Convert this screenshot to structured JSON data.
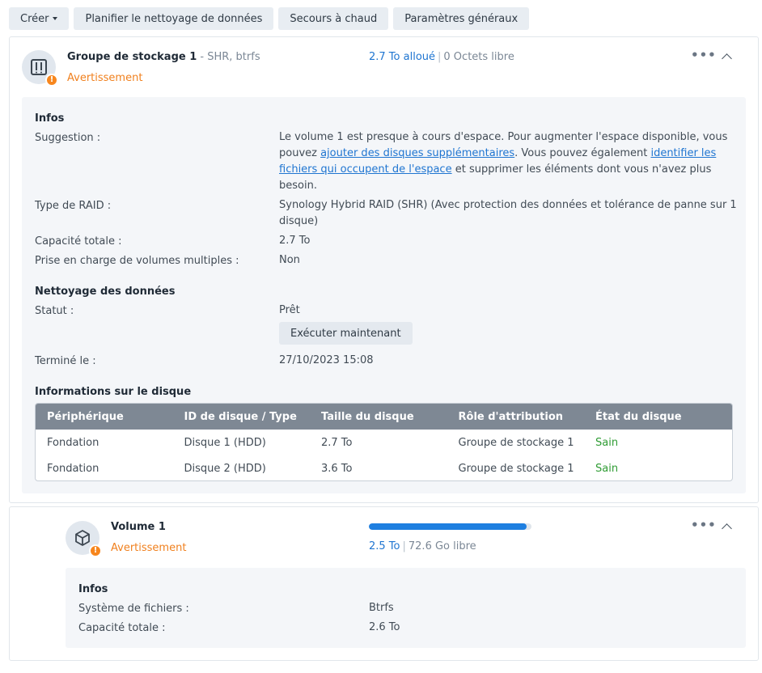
{
  "toolbar": {
    "create_label": "Créer",
    "schedule_label": "Planifier le nettoyage de données",
    "hotspare_label": "Secours à chaud",
    "settings_label": "Paramètres généraux"
  },
  "pool": {
    "title": "Groupe de stockage 1",
    "subtitle": "- SHR, btrfs",
    "status": "Avertissement",
    "allocated": "2.7 To alloué",
    "separator": "|",
    "free": "0 Octets libre",
    "info": {
      "heading": "Infos",
      "suggestion_label": "Suggestion :",
      "suggestion_part1": "Le volume 1 est presque à cours d'espace. Pour augmenter l'espace disponible, vous pouvez ",
      "suggestion_link1": "ajouter des disques supplémentaires",
      "suggestion_part2": ". Vous pouvez également ",
      "suggestion_link2": "identifier les fichiers qui occupent de l'espace",
      "suggestion_part3": " et supprimer les éléments dont vous n'avez plus besoin.",
      "raid_label": "Type de RAID :",
      "raid_value": "Synology Hybrid RAID (SHR) (Avec protection des données et tolérance de panne sur 1 disque)",
      "capacity_label": "Capacité totale :",
      "capacity_value": "2.7 To",
      "multi_label": "Prise en charge de volumes multiples :",
      "multi_value": "Non"
    },
    "scrub": {
      "heading": "Nettoyage des données",
      "status_label": "Statut :",
      "status_value": "Prêt",
      "run_label": "Exécuter maintenant",
      "done_label": "Terminé le :",
      "done_value": "27/10/2023 15:08"
    },
    "disks": {
      "heading": "Informations sur le disque",
      "columns": [
        "Périphérique",
        "ID de disque / Type",
        "Taille du disque",
        "Rôle d'attribution",
        "État du disque"
      ],
      "rows": [
        [
          "Fondation",
          "Disque 1 (HDD)",
          "2.7 To",
          "Groupe de stockage 1",
          "Sain"
        ],
        [
          "Fondation",
          "Disque 2 (HDD)",
          "3.6 To",
          "Groupe de stockage 1",
          "Sain"
        ]
      ]
    }
  },
  "volume": {
    "title": "Volume 1",
    "status": "Avertissement",
    "used": "2.5 To",
    "separator": "|",
    "free": "72.6 Go libre",
    "usage_fraction": 0.97,
    "info": {
      "heading": "Infos",
      "fs_label": "Système de fichiers :",
      "fs_value": "Btrfs",
      "capacity_label": "Capacité totale :",
      "capacity_value": "2.6 To"
    }
  },
  "colors": {
    "warning": "#f0801e",
    "link": "#1f75d1",
    "healthy": "#2f9c34",
    "table_header": "#7e8894"
  },
  "icons": {
    "pool": "nas-drive-icon",
    "volume": "cube-icon",
    "warning": "exclamation-badge-icon",
    "more": "more-dots-icon",
    "collapse": "chevron-up-icon"
  }
}
